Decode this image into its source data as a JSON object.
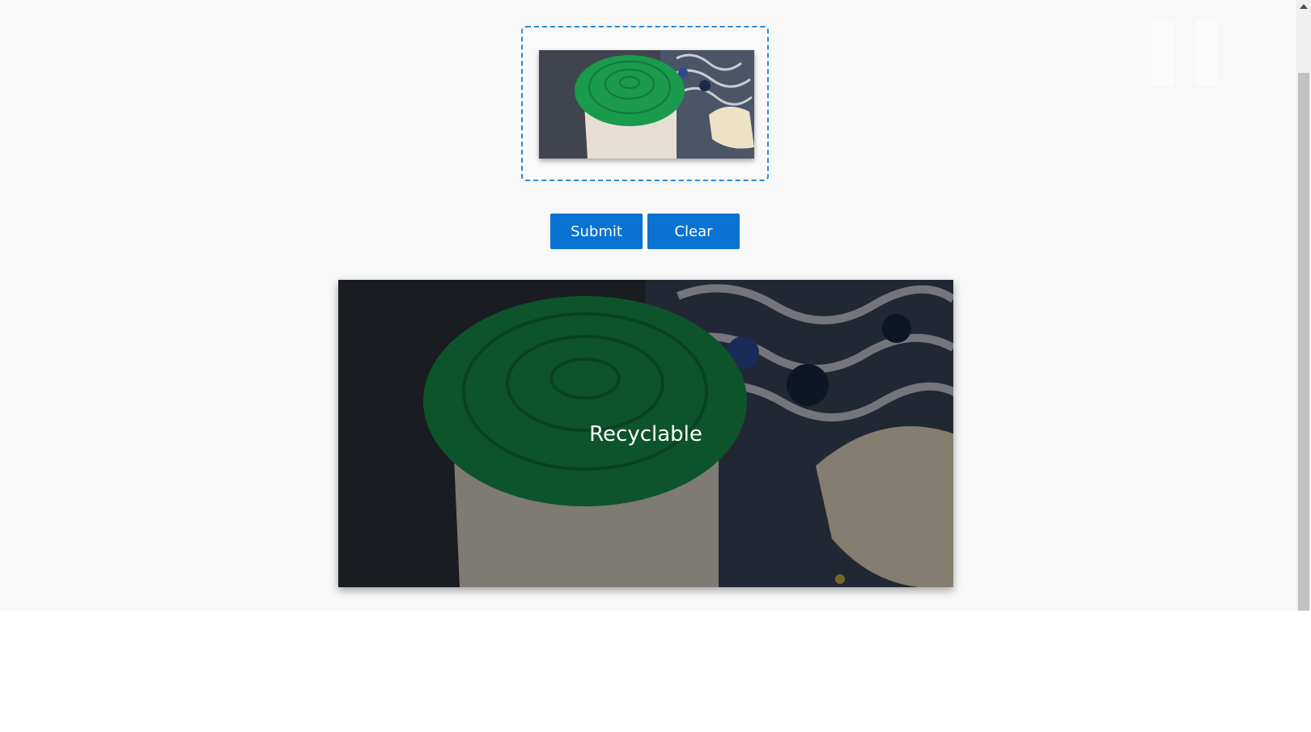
{
  "upload": {
    "thumbnail_alt": "uploaded photo: cylindrical container with green lid"
  },
  "actions": {
    "submit_label": "Submit",
    "clear_label": "Clear"
  },
  "result": {
    "label": "Recyclable"
  },
  "colors": {
    "accent": "#0a72d1",
    "dropzone_border": "#2b8ad8",
    "background": "#f8f8f8",
    "lid": "#1c9a4e"
  }
}
